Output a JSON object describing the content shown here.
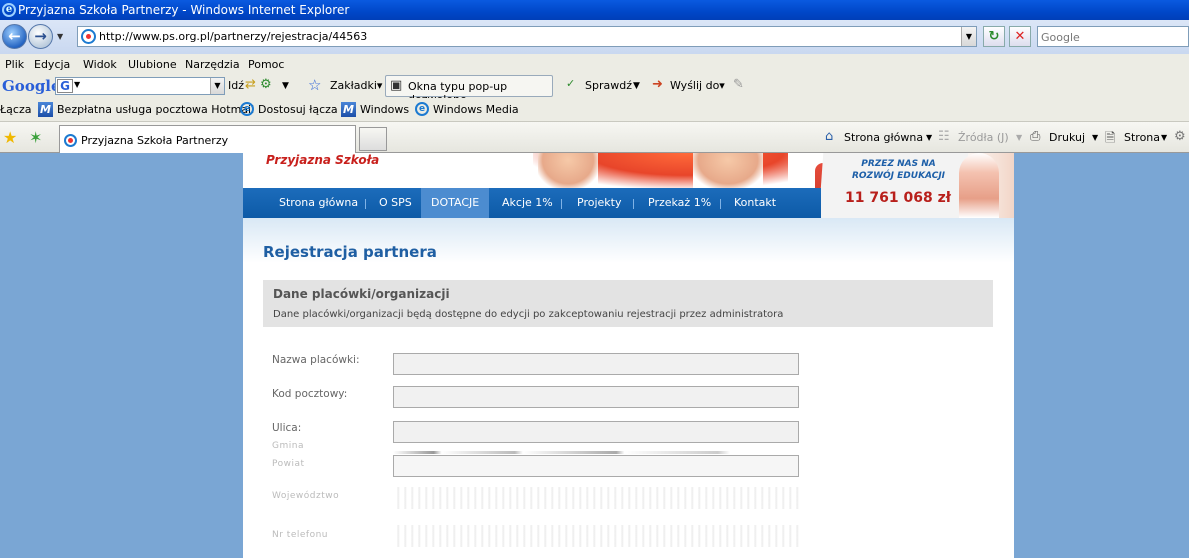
{
  "window": {
    "title": "Przyjazna Szkoła Partnerzy - Windows Internet Explorer"
  },
  "address": {
    "url": "http://www.ps.org.pl/partnerzy/rejestracja/44563"
  },
  "search": {
    "placeholder": "Google"
  },
  "menu": [
    "Plik",
    "Edycja",
    "Widok",
    "Ulubione",
    "Narzędzia",
    "Pomoc"
  ],
  "google_toolbar": {
    "logo": "Google",
    "go": "Idź",
    "bookmarks": "Zakładki▾",
    "popups": "Okna typu pop-up dozwolone",
    "check": "Sprawdź",
    "send": "Wyślij do▾"
  },
  "links": {
    "label": "Łącza",
    "items": [
      "Bezpłatna usługa pocztowa Hotmail",
      "Dostosuj łącza",
      "Windows",
      "Windows Media"
    ]
  },
  "tab": {
    "label": "Przyjazna Szkoła Partnerzy"
  },
  "commands": {
    "home": "Strona główna",
    "feeds": "Źródła (J)",
    "print": "Drukuj",
    "page": "Strona"
  },
  "site": {
    "brand": "Przyjazna Szkoła",
    "donation_text": "PRZEZ NAS NA ROZWÓJ EDUKACJI",
    "donation_amount": "11 761 068 zł",
    "nav": [
      "Strona główna",
      "O SPS",
      "DOTACJE",
      "Akcje 1%",
      "Projekty",
      "Przekaż 1%",
      "Kontakt"
    ],
    "active_nav": "DOTACJE",
    "page_title": "Rejestracja partnera",
    "section_title": "Dane placówki/organizacji",
    "section_desc": "Dane placówki/organizacji będą dostępne do edycji po zakceptowaniu rejestracji przez administratora",
    "fields": [
      "Nazwa placówki:",
      "Kod pocztowy:",
      "Ulica:"
    ],
    "faded_labels": [
      "Gmina",
      "Powiat",
      "Województwo"
    ],
    "faded_last": "Nr telefonu"
  }
}
